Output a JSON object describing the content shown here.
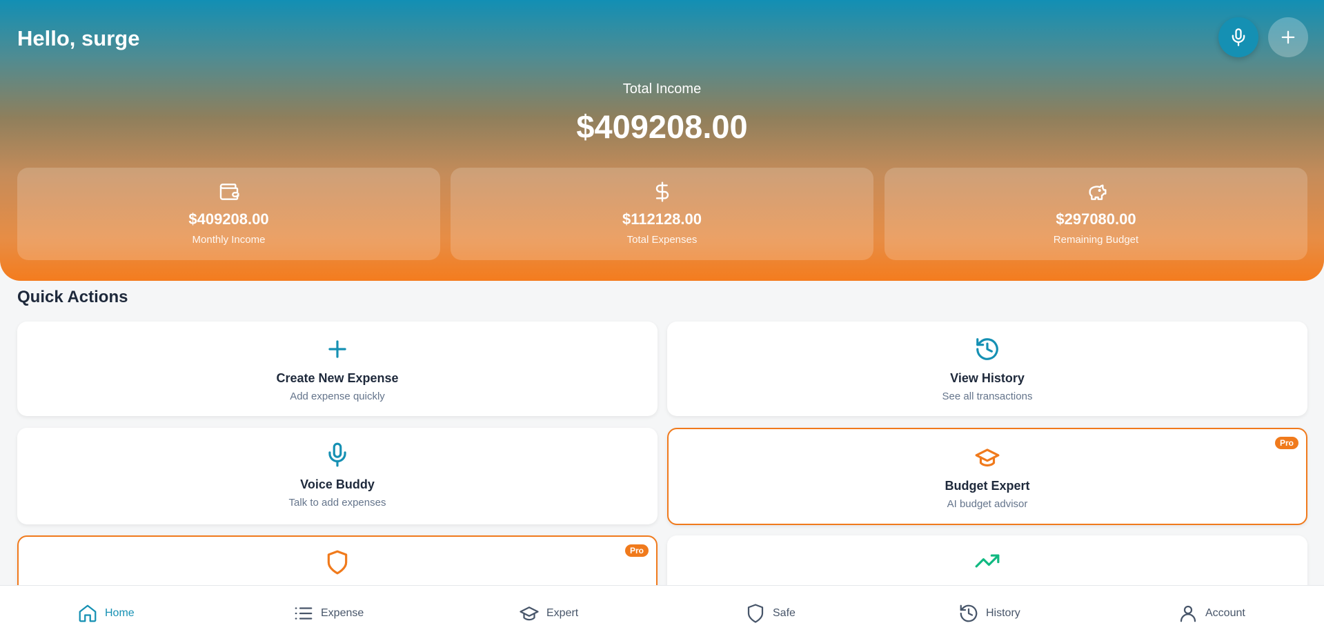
{
  "header": {
    "greeting": "Hello, surge",
    "mic_icon": "microphone-icon",
    "add_icon": "plus-icon"
  },
  "summary": {
    "total_income_label": "Total Income",
    "total_income_value": "$409208.00"
  },
  "stats": [
    {
      "icon": "wallet-icon",
      "value": "$409208.00",
      "label": "Monthly Income"
    },
    {
      "icon": "dollar-icon",
      "value": "$112128.00",
      "label": "Total Expenses"
    },
    {
      "icon": "piggy-bank-icon",
      "value": "$297080.00",
      "label": "Remaining Budget"
    }
  ],
  "quick_actions": {
    "title": "Quick Actions",
    "items": [
      {
        "icon": "plus-icon",
        "title": "Create New Expense",
        "subtitle": "Add expense quickly",
        "pro": false
      },
      {
        "icon": "history-icon",
        "title": "View History",
        "subtitle": "See all transactions",
        "pro": false
      },
      {
        "icon": "microphone-icon",
        "title": "Voice Buddy",
        "subtitle": "Talk to add expenses",
        "pro": false
      },
      {
        "icon": "graduation-cap-icon",
        "title": "Budget Expert",
        "subtitle": "AI budget advisor",
        "pro": true,
        "badge": "Pro"
      },
      {
        "icon": "shield-icon",
        "title": "",
        "subtitle": "",
        "pro": true,
        "badge": "Pro"
      },
      {
        "icon": "trending-up-icon",
        "title": "",
        "subtitle": "",
        "pro": false
      }
    ]
  },
  "nav": {
    "items": [
      {
        "icon": "home-icon",
        "label": "Home",
        "active": true
      },
      {
        "icon": "list-icon",
        "label": "Expense",
        "active": false
      },
      {
        "icon": "graduation-cap-icon",
        "label": "Expert",
        "active": false
      },
      {
        "icon": "shield-icon",
        "label": "Safe",
        "active": false
      },
      {
        "icon": "history-icon",
        "label": "History",
        "active": false
      },
      {
        "icon": "user-icon",
        "label": "Account",
        "active": false
      }
    ]
  },
  "colors": {
    "primary": "#1590b3",
    "accent": "#f07a1c",
    "success": "#10b981",
    "text": "#1e293b",
    "muted": "#64748b"
  }
}
